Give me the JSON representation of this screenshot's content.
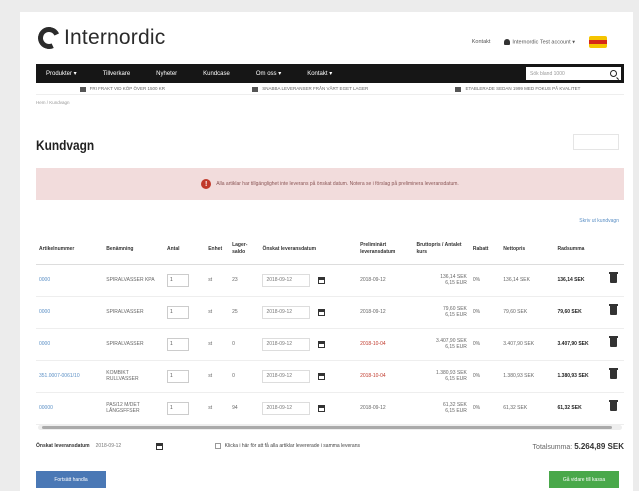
{
  "brand": {
    "name": "Internordic"
  },
  "top_links": {
    "contact": "Kontakt",
    "account": "Internordic Test account ▾"
  },
  "nav": {
    "items": [
      "Produkter ▾",
      "Tillverkare",
      "Nyheter",
      "Kundcase",
      "Om oss ▾",
      "Kontakt ▾"
    ],
    "search_placeholder": "Sök bland 1000"
  },
  "usp": [
    "FRI FRAKT VID KÖP ÖVER 1500 KR",
    "SNABBA LEVERANSER FRÅN VÅRT EGET LAGER",
    "ETABLERADE SEDAN 1999 MED FOKUS PÅ KVALITET"
  ],
  "breadcrumb": "Hem / Kundvagn",
  "page_title": "Kundvagn",
  "alert": {
    "icon": "!",
    "text": "Alla artiklar har tillgänglighet inte leverans på önskat datum. Notera se i förslag på preliminera leveransdatum."
  },
  "print_link": "Skriv ut kundvagn",
  "table": {
    "headers": [
      "Artikelnummer",
      "Benämning",
      "Antal",
      "Enhet",
      "Lager-saldo",
      "Önskat leveransdatum",
      "Preliminärt leveransdatum",
      "Bruttopris / Antalet kurs",
      "Rabatt",
      "Nettopris",
      "Radsumma",
      ""
    ],
    "rows": [
      {
        "article": "0000",
        "name": "SPIRALVASSER KPA",
        "qty": "1",
        "unit": "st",
        "stock": "23",
        "wish": "2018-09-12",
        "prelim": "2018-09-12",
        "prelim_red": false,
        "gross": "136,14 SEK",
        "gross2": "6,15 EUR",
        "disc": "0%",
        "net": "136,14 SEK",
        "sum": "136,14 SEK"
      },
      {
        "article": "0000",
        "name": "SPIRALVASSER",
        "qty": "1",
        "unit": "st",
        "stock": "25",
        "wish": "2018-09-12",
        "prelim": "2018-09-12",
        "prelim_red": false,
        "gross": "79,60 SEK",
        "gross2": "6,15 EUR",
        "disc": "0%",
        "net": "79,60 SEK",
        "sum": "79,60 SEK"
      },
      {
        "article": "0000",
        "name": "SPIRALVASSER",
        "qty": "1",
        "unit": "st",
        "stock": "0",
        "wish": "2018-09-12",
        "prelim": "2018-10-04",
        "prelim_red": true,
        "gross": "3.407,90 SEK",
        "gross2": "6,15 EUR",
        "disc": "0%",
        "net": "3.407,90 SEK",
        "sum": "3.407,90 SEK"
      },
      {
        "article": "351.0007-0061/10",
        "name": "KOMBIKT RULLVASSER",
        "qty": "1",
        "unit": "st",
        "stock": "0",
        "wish": "2018-09-12",
        "prelim": "2018-10-04",
        "prelim_red": true,
        "gross": "1.380,93 SEK",
        "gross2": "6,15 EUR",
        "disc": "0%",
        "net": "1.380,93 SEK",
        "sum": "1.380,93 SEK"
      },
      {
        "article": "00000",
        "name": "PAS/12 M/DET LÅNGSFFSER",
        "qty": "1",
        "unit": "st",
        "stock": "94",
        "wish": "2018-09-12",
        "prelim": "2018-09-12",
        "prelim_red": false,
        "gross": "61,32 SEK",
        "gross2": "6,15 EUR",
        "disc": "0%",
        "net": "61,32 SEK",
        "sum": "61,32 SEK"
      }
    ]
  },
  "footer": {
    "wish_label": "Önskat leveransdatum",
    "wish_value": "2018-09-12",
    "checkbox_label": "Klicka i här för att få alla artiklar levererade i samma leverans",
    "total_label": "Totalsumma:",
    "total_value": "5.264,89 SEK"
  },
  "buttons": {
    "continue": "Fortsätt handla",
    "checkout": "Gå vidare till kassa"
  },
  "colors": {
    "nav_bg": "#161616",
    "alert_bg": "#f2dcdc",
    "link": "#5a8fc5",
    "primary_btn": "#4a78b5",
    "checkout_btn": "#49a84a",
    "warning_red": "#c0392b"
  }
}
